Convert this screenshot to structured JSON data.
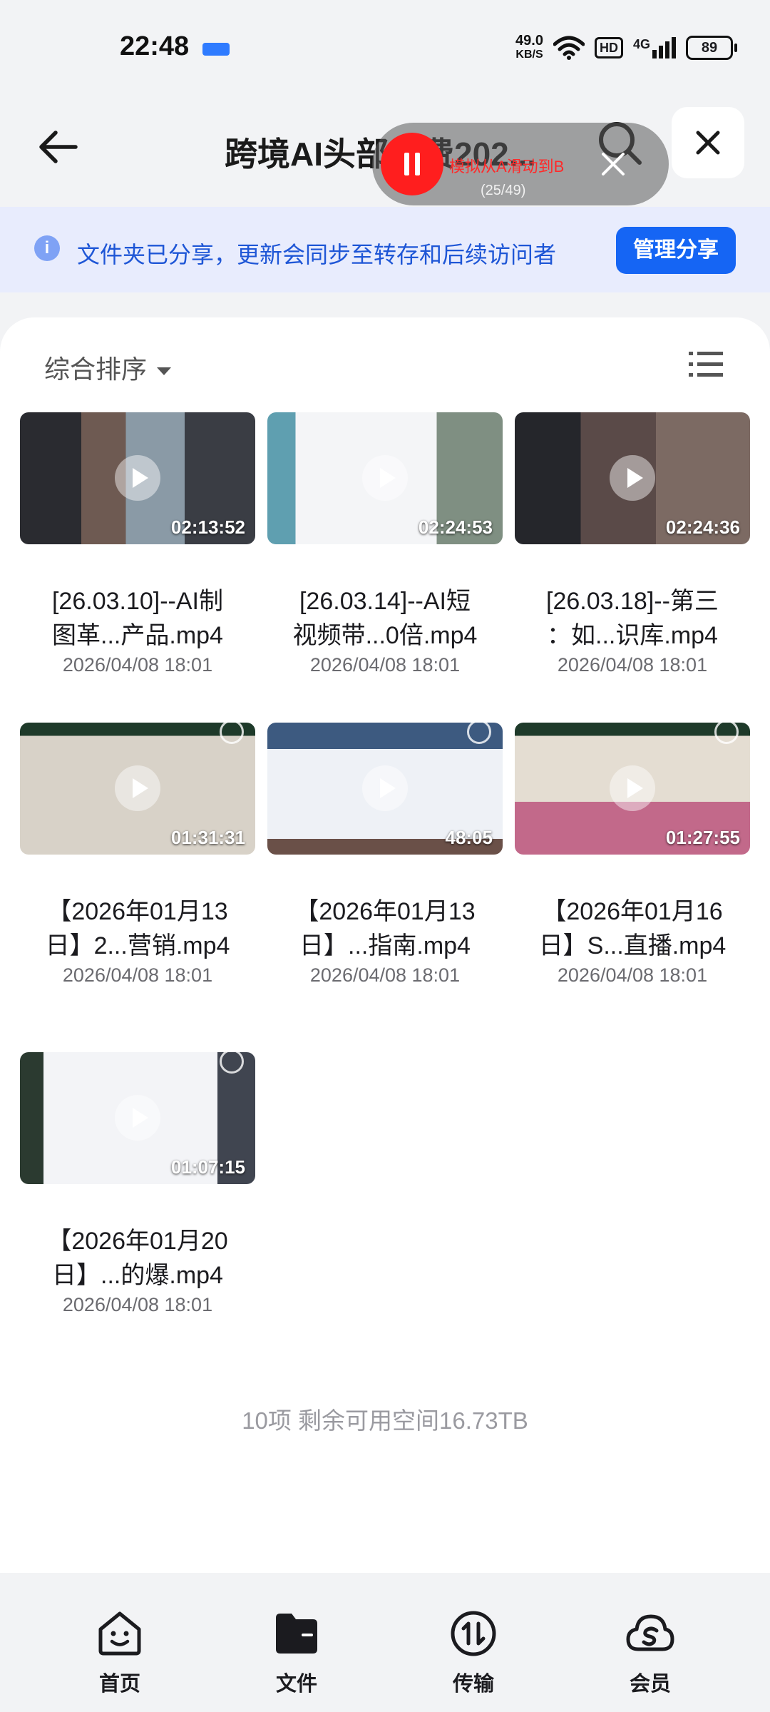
{
  "status_bar": {
    "time": "22:48",
    "net_speed_value": "49.0",
    "net_speed_unit": "KB/S",
    "hd": "HD",
    "signal": "4G",
    "battery": "89"
  },
  "header": {
    "title": "跨境AI头部年费202...",
    "back_icon": "arrow-left-icon",
    "search_icon": "search-icon",
    "close_icon": "close-icon"
  },
  "recording": {
    "label": "模拟从A滑动到B",
    "progress_text": "(25/49)",
    "progress_current": 25,
    "progress_total": 49,
    "accent": "#ff1e1e"
  },
  "banner": {
    "text": "文件夹已分享，更新会同步至转存和后续访问者",
    "button": "管理分享",
    "accent": "#1565f4"
  },
  "toolbar": {
    "sort_label": "综合排序",
    "view_icon": "list-view-icon"
  },
  "files": [
    {
      "duration": "02:13:52",
      "name_line1": "[26.03.10]--AI制",
      "name_line2": "图革...产品.mp4",
      "date": "2026/04/08 18:01"
    },
    {
      "duration": "02:24:53",
      "name_line1": "[26.03.14]--AI短",
      "name_line2": "视频带...0倍.mp4",
      "date": "2026/04/08 18:01"
    },
    {
      "duration": "02:24:36",
      "name_line1": "[26.03.18]--第三",
      "name_line2": "：如...识库.mp4",
      "date": "2026/04/08 18:01"
    },
    {
      "duration": "01:31:31",
      "name_line1": "【2026年01月13",
      "name_line2": "日】2...营销.mp4",
      "date": "2026/04/08 18:01"
    },
    {
      "duration": "48:05",
      "name_line1": "【2026年01月13",
      "name_line2": "日】...指南.mp4",
      "date": "2026/04/08 18:01"
    },
    {
      "duration": "01:27:55",
      "name_line1": "【2026年01月16",
      "name_line2": "日】S...直播.mp4",
      "date": "2026/04/08 18:01"
    },
    {
      "duration": "01:07:15",
      "name_line1": "【2026年01月20",
      "name_line2": "日】...的爆.mp4",
      "date": "2026/04/08 18:01"
    }
  ],
  "footer": {
    "info": "10项 剩余可用空间16.73TB"
  },
  "nav": {
    "items": [
      {
        "label": "首页",
        "icon": "home-smile-icon"
      },
      {
        "label": "文件",
        "icon": "folder-icon"
      },
      {
        "label": "传输",
        "icon": "transfer-icon"
      },
      {
        "label": "会员",
        "icon": "cloud-member-icon"
      }
    ]
  }
}
